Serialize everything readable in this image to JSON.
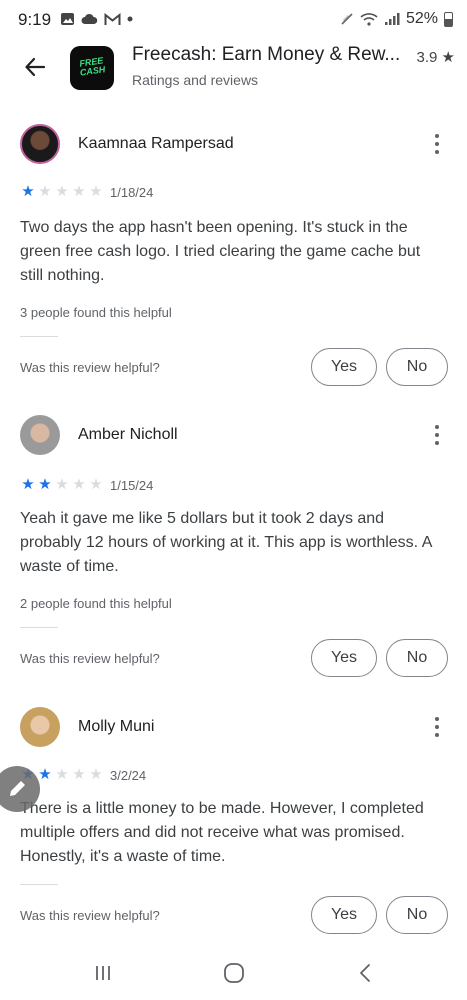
{
  "status_bar": {
    "time": "9:19",
    "battery": "52%",
    "left_icons": [
      "gallery-icon",
      "cloud-icon",
      "gmail-icon",
      "dot-icon"
    ],
    "right_icons": [
      "mute-icon",
      "wifi-icon",
      "signal-icon"
    ]
  },
  "header": {
    "app_name": "Freecash: Earn Money & Rew...",
    "subtitle": "Ratings and reviews",
    "rating": "3.9 ★",
    "app_icon_text": "FREE CASH"
  },
  "reviews": [
    {
      "author": "Kaamnaa Rampersad",
      "rating": 1,
      "date": "1/18/24",
      "text": "Two days the app hasn't been opening. It's stuck in the green free cash logo. I tried clearing the game cache but still nothing.",
      "helpful_count": "3 people found this helpful",
      "helpful_question": "Was this review helpful?",
      "yes_label": "Yes",
      "no_label": "No"
    },
    {
      "author": "Amber Nicholl",
      "rating": 2,
      "date": "1/15/24",
      "text": "Yeah it gave me like 5 dollars but it took 2 days and probably 12 hours of working at it. This app is worthless. A waste of time.",
      "helpful_count": "2 people found this helpful",
      "helpful_question": "Was this review helpful?",
      "yes_label": "Yes",
      "no_label": "No"
    },
    {
      "author": "Molly Muni",
      "rating": 2,
      "date": "3/2/24",
      "text": "There is a little money to be made. However, I completed multiple offers and did not receive what was promised. Honestly, it's a waste of time.",
      "helpful_question": "Was this review helpful?",
      "yes_label": "Yes",
      "no_label": "No"
    }
  ],
  "colors": {
    "star_filled": "#1a73e8",
    "star_empty": "#dadce0",
    "text_primary": "#202124",
    "text_secondary": "#5f6368"
  },
  "nav": [
    "recents-icon",
    "home-icon",
    "back-icon"
  ]
}
